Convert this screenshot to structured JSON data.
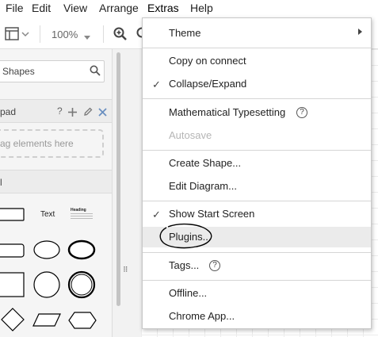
{
  "menubar": {
    "items": [
      "File",
      "Edit",
      "View",
      "Arrange",
      "Extras",
      "Help"
    ]
  },
  "toolbar": {
    "zoom": "100%"
  },
  "sidebar": {
    "search_placeholder": "Shapes",
    "scratchpad_label": "pad",
    "scratchpad_help": "?",
    "drag_hint": "ag elements here",
    "general_label": "l",
    "shape_text": "Text",
    "shape_heading": "Heading"
  },
  "extras_menu": {
    "theme": "Theme",
    "copy_on_connect": "Copy on connect",
    "collapse_expand": "Collapse/Expand",
    "math_typesetting": "Mathematical Typesetting",
    "autosave": "Autosave",
    "create_shape": "Create Shape...",
    "edit_diagram": "Edit Diagram...",
    "show_start_screen": "Show Start Screen",
    "plugins": "Plugins...",
    "tags": "Tags...",
    "offline": "Offline...",
    "chrome_app": "Chrome App...",
    "help_glyph": "?",
    "check_glyph": "✓"
  },
  "canvas": {
    "splitter_glyph": "⠿"
  },
  "colors": {
    "menu_hover": "#ebebeb",
    "disabled_text": "#b5b5b5",
    "annotation_stroke": "#000000"
  }
}
